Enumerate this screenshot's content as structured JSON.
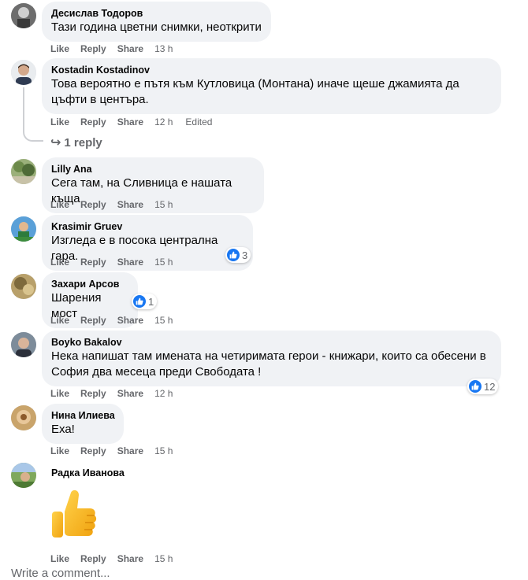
{
  "actions": {
    "like": "Like",
    "reply": "Reply",
    "share": "Share"
  },
  "comments": [
    {
      "author": "Десислав Тодоров",
      "text": "Тази година цветни снимки, неоткрити",
      "time": "13 h"
    },
    {
      "author": "Kostadin Kostadinov",
      "text": "Това вероятно е пътя към Кутловица (Монтана) иначе щеше джамията да цъфти в центъра.",
      "time": "12 h",
      "edited": "Edited",
      "replies": "1 reply"
    },
    {
      "author": "Lilly Ana",
      "text": "Сега там, на Сливница е нашата къща",
      "time": "15 h"
    },
    {
      "author": "Krasimir Gruev",
      "text": "Изгледа е в посока централна гара.",
      "time": "15 h",
      "reactions": "3"
    },
    {
      "author": "Захари Арсов",
      "text": "Шарения мост",
      "time": "15 h",
      "reactions": "1"
    },
    {
      "author": "Boyko Bakalov",
      "text": "Нека напишат там имената на четиримата герои - книжари, които са обесени в София два месеца преди Свободата !",
      "time": "12 h",
      "reactions": "12"
    },
    {
      "author": "Нина Илиева",
      "text": "Еха!",
      "time": "15 h"
    },
    {
      "author": "Радка Иванова",
      "sticker": "thumbs-up",
      "time": "15 h"
    }
  ],
  "write_comment": "Write a comment...",
  "colors": {
    "bubble": "#f0f2f5",
    "meta": "#65676b",
    "like_blue": "#1877f2"
  }
}
